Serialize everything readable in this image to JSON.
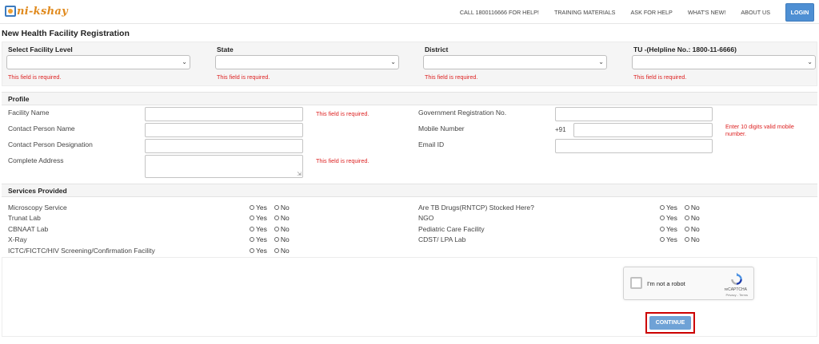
{
  "header": {
    "logo_text": "ni-kshay",
    "nav": [
      "CALL 1800116666 FOR HELP!",
      "TRAINING MATERIALS",
      "ASK FOR HELP",
      "WHAT'S NEW!",
      "ABOUT US"
    ],
    "login_label": "LOGIN",
    "accent": "#4e8fd3",
    "logo_color": "#e08a1e"
  },
  "page_title": "New Health Facility Registration",
  "facility_selects": [
    {
      "label": "Select Facility Level",
      "value": "",
      "error": "This field is required."
    },
    {
      "label": "State",
      "value": "",
      "error": "This field is required."
    },
    {
      "label": "District",
      "value": "",
      "error": "This field is required."
    },
    {
      "label": "TU -(Helpline No.: 1800-11-6666)",
      "value": "",
      "error": "This field is required."
    }
  ],
  "profile": {
    "heading": "Profile",
    "facility_name": {
      "label": "Facility Name",
      "value": "",
      "error": "This field is required."
    },
    "contact_person_name": {
      "label": "Contact Person Name",
      "value": ""
    },
    "contact_person_designation": {
      "label": "Contact Person Designation",
      "value": ""
    },
    "complete_address": {
      "label": "Complete Address",
      "value": "",
      "error": "This field is required."
    },
    "government_registration": {
      "label": "Government Registration No.",
      "value": ""
    },
    "mobile_number": {
      "label": "Mobile Number",
      "prefix": "+91",
      "value": "",
      "error": "Enter 10 digits valid mobile number."
    },
    "email": {
      "label": "Email ID",
      "value": ""
    }
  },
  "services": {
    "heading": "Services Provided",
    "yes_label": "Yes",
    "no_label": "No",
    "left": [
      "Microscopy Service",
      "Trunat Lab",
      "CBNAAT Lab",
      "X-Ray",
      "ICTC/FICTC/HIV Screening/Confirmation Facility"
    ],
    "right": [
      "Are TB Drugs(RNTCP) Stocked Here?",
      "NGO",
      "Pediatric Care Facility",
      "CDST/ LPA Lab"
    ]
  },
  "captcha": {
    "label": "I'm not a robot",
    "brand": "reCAPTCHA",
    "links": "Privacy - Terms"
  },
  "continue_label": "CONTINUE",
  "error_color": "#dd2222"
}
